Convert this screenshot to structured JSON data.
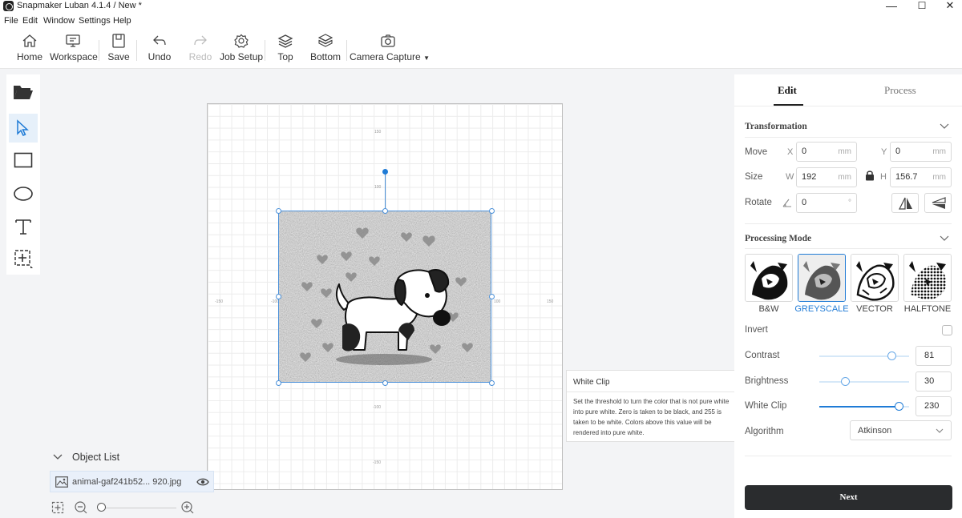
{
  "titlebar": {
    "title": "Snapmaker Luban 4.1.4 / New *",
    "minimize": "—",
    "maximize": "☐",
    "close": "✕"
  },
  "menu": [
    "File",
    "Edit",
    "Window",
    "Settings",
    "Help"
  ],
  "toolbar": {
    "home": "Home",
    "workspace": "Workspace",
    "save": "Save",
    "undo": "Undo",
    "redo": "Redo",
    "job_setup": "Job Setup",
    "top": "Top",
    "bottom": "Bottom",
    "camera_capture": "Camera Capture"
  },
  "canvas": {
    "ticks": {
      "top_150": "150",
      "top_100": "100",
      "left_150": "-150",
      "left_100": "-100",
      "right_100": "100",
      "right_150": "150",
      "bottom_100": "-100",
      "bottom_150": "-150"
    }
  },
  "tooltip": {
    "title": "White Clip",
    "body": "Set the threshold to turn the color that is not pure white into pure white. Zero is taken to be black, and 255 is taken to be white. Colors above this value will be rendered into pure white."
  },
  "object_list": {
    "title": "Object List",
    "items": [
      {
        "name": "animal-gaf241b52... 920.jpg"
      }
    ]
  },
  "panel": {
    "tabs": {
      "edit": "Edit",
      "process": "Process"
    },
    "transformation": {
      "title": "Transformation",
      "move_label": "Move",
      "size_label": "Size",
      "rotate_label": "Rotate",
      "x_axis": "X",
      "y_axis": "Y",
      "w_axis": "W",
      "h_axis": "H",
      "x": "0",
      "y": "0",
      "w": "192",
      "h": "156.7",
      "rotate": "0",
      "unit": "mm",
      "deg": "°"
    },
    "processing_mode": {
      "title": "Processing Mode",
      "modes": [
        "B&W",
        "GREYSCALE",
        "VECTOR",
        "HALFTONE"
      ],
      "selected": "GREYSCALE",
      "invert_label": "Invert",
      "invert": false,
      "contrast_label": "Contrast",
      "contrast": "81",
      "brightness_label": "Brightness",
      "brightness": "30",
      "white_clip_label": "White Clip",
      "white_clip": "230",
      "algorithm_label": "Algorithm",
      "algorithm": "Atkinson"
    },
    "next": "Next"
  },
  "colors": {
    "accent": "#1f7bd6",
    "dark_button": "#2a2c2e"
  }
}
